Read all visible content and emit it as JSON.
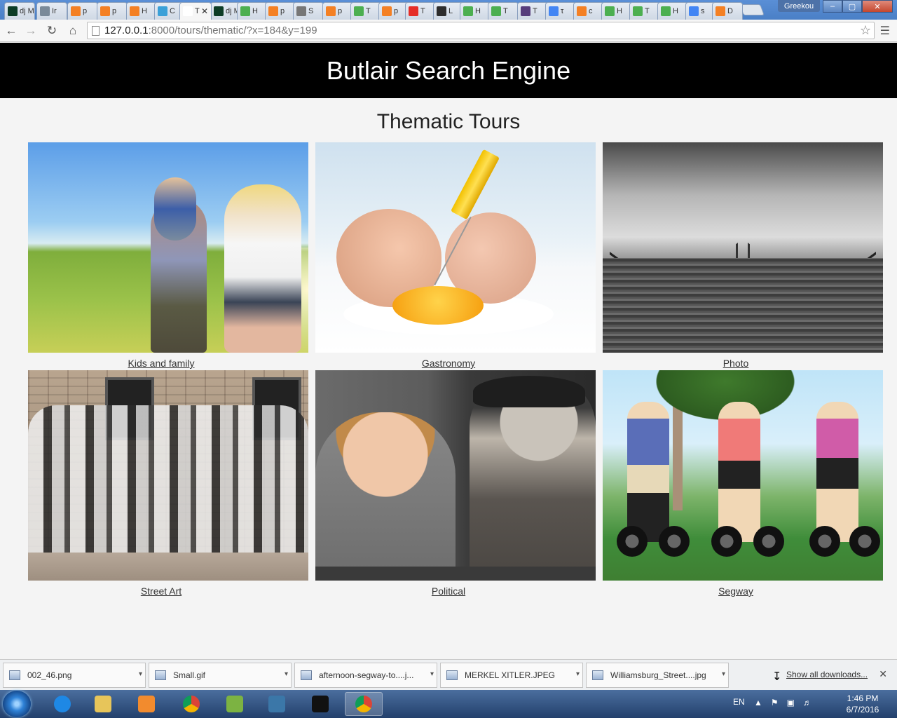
{
  "browser": {
    "tabs": [
      {
        "icon": "django-icon",
        "label": "dj M",
        "color": "#0c3c26"
      },
      {
        "icon": "document-icon",
        "label": "Ir",
        "color": "#7a8a99"
      },
      {
        "icon": "stackoverflow-icon",
        "label": "p",
        "color": "#f48024"
      },
      {
        "icon": "stackoverflow-icon",
        "label": "p",
        "color": "#f48024"
      },
      {
        "icon": "stackoverflow-icon",
        "label": "H",
        "color": "#f48024"
      },
      {
        "icon": "dots-icon",
        "label": "C",
        "color": "#3aa0d8"
      },
      {
        "icon": "page-icon",
        "label": "T",
        "color": "#ffffff",
        "active": true
      },
      {
        "icon": "django-icon",
        "label": "dj M",
        "color": "#0c3c26"
      },
      {
        "icon": "w3-icon",
        "label": "H",
        "color": "#4caf50"
      },
      {
        "icon": "stackoverflow-icon",
        "label": "p",
        "color": "#f48024"
      },
      {
        "icon": "puzzle-icon",
        "label": "S",
        "color": "#777777"
      },
      {
        "icon": "stackoverflow-icon",
        "label": "p",
        "color": "#f48024"
      },
      {
        "icon": "w3-icon",
        "label": "T",
        "color": "#4caf50"
      },
      {
        "icon": "stackoverflow-icon",
        "label": "p",
        "color": "#f48024"
      },
      {
        "icon": "youtube-icon",
        "label": "T",
        "color": "#e52d27"
      },
      {
        "icon": "badge-icon",
        "label": "L",
        "color": "#2d2d2d"
      },
      {
        "icon": "w3-icon",
        "label": "H",
        "color": "#4caf50"
      },
      {
        "icon": "w3-icon",
        "label": "T",
        "color": "#4caf50"
      },
      {
        "icon": "bootstrap-icon",
        "label": "T",
        "color": "#563d7c"
      },
      {
        "icon": "google-icon",
        "label": "τ",
        "color": "#4285f4"
      },
      {
        "icon": "stackoverflow-icon",
        "label": "c",
        "color": "#f48024"
      },
      {
        "icon": "w3-icon",
        "label": "H",
        "color": "#4caf50"
      },
      {
        "icon": "w3-icon",
        "label": "T",
        "color": "#4caf50"
      },
      {
        "icon": "w3-icon",
        "label": "H",
        "color": "#4caf50"
      },
      {
        "icon": "google-icon",
        "label": "s",
        "color": "#4285f4"
      },
      {
        "icon": "stackoverflow-icon",
        "label": "D",
        "color": "#f48024"
      }
    ],
    "user": "Greekou",
    "window_buttons": {
      "minimize": "–",
      "maximize": "▢",
      "close": "✕"
    },
    "url_host": "127.0.0.1",
    "url_rest": ":8000/tours/thematic/?x=184&y=199"
  },
  "site": {
    "title": "Butlair Search Engine",
    "heading": "Thematic Tours"
  },
  "tours": [
    {
      "label": "Kids and family",
      "theme": "kids"
    },
    {
      "label": "Gastronomy",
      "theme": "egg"
    },
    {
      "label": "Photo",
      "theme": "photo"
    },
    {
      "label": "Street Art",
      "theme": "street"
    },
    {
      "label": "Political",
      "theme": "political"
    },
    {
      "label": "Segway",
      "theme": "segway"
    }
  ],
  "downloads": {
    "items": [
      "002_46.png",
      "Small.gif",
      "afternoon-segway-to....j...",
      "MERKEL XITLER.JPEG",
      "Williamsburg_Street....jpg"
    ],
    "show_all": "Show all downloads..."
  },
  "taskbar": {
    "apps": [
      {
        "name": "ie-icon",
        "color": "#1e88e5"
      },
      {
        "name": "explorer-icon",
        "color": "#e7c55a"
      },
      {
        "name": "media-player-icon",
        "color": "#f28b2e"
      },
      {
        "name": "chrome-icon",
        "color": "#db4437"
      },
      {
        "name": "notepad-plus-icon",
        "color": "#7cb342"
      },
      {
        "name": "python-icon",
        "color": "#3b77a8"
      },
      {
        "name": "cmd-icon",
        "color": "#111111"
      },
      {
        "name": "chrome-icon",
        "color": "#db4437",
        "active": true
      }
    ],
    "language": "EN",
    "time": "1:46 PM",
    "date": "6/7/2016"
  }
}
